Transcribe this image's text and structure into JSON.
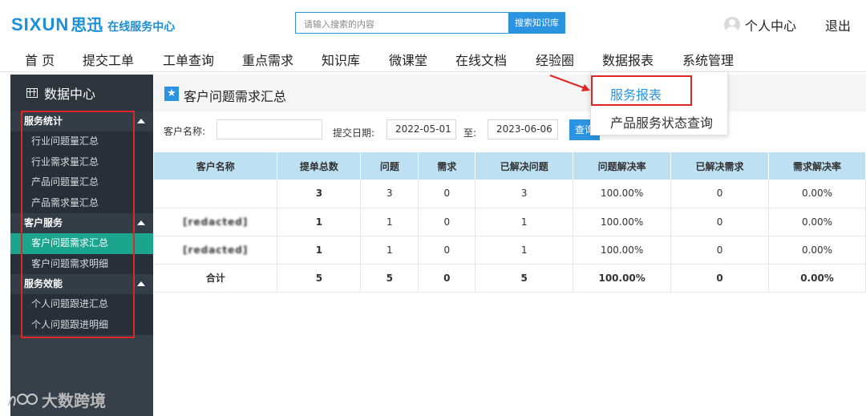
{
  "header": {
    "logo_text": "SIXUN",
    "logo_cn": "思迅",
    "logo_sub": "在线服务中心",
    "search_placeholder": "请输入搜索的内容",
    "search_button": "搜索知识库",
    "user_center": "个人中心",
    "logout": "退出"
  },
  "nav": {
    "items": [
      "首 页",
      "提交工单",
      "工单查询",
      "重点需求",
      "知识库",
      "微课堂",
      "在线文档",
      "经验圈",
      "数据报表",
      "系统管理"
    ],
    "active_index": 8
  },
  "dropdown": {
    "items": [
      "服务报表",
      "产品服务状态查询"
    ],
    "active": "服务报表"
  },
  "sidebar": {
    "title": "数据中心",
    "groups": [
      {
        "title": "服务统计",
        "items": [
          "行业问题量汇总",
          "行业需求量汇总",
          "产品问题量汇总",
          "产品需求量汇总"
        ]
      },
      {
        "title": "客户服务",
        "items": [
          "客户问题需求汇总",
          "客户问题需求明细"
        ]
      },
      {
        "title": "服务效能",
        "items": [
          "个人问题跟进汇总",
          "个人问题跟进明细"
        ]
      }
    ],
    "active_item": "客户问题需求汇总"
  },
  "content": {
    "title": "客户问题需求汇总",
    "filters": {
      "customer_label": "客户名称:",
      "customer_value": "",
      "date_label": "提交日期:",
      "date_from": "2022-05-01",
      "to_label": "至:",
      "date_to": "2023-06-06",
      "query_button": "查询"
    }
  },
  "table": {
    "headers": [
      "客户名称",
      "提单总数",
      "问题",
      "需求",
      "已解决问题",
      "问题解决率",
      "已解决需求",
      "需求解决率"
    ],
    "rows": [
      [
        "",
        "3",
        "3",
        "0",
        "3",
        "100.00%",
        "0",
        "0.00%"
      ],
      [
        "[redacted]",
        "1",
        "1",
        "0",
        "1",
        "100.00%",
        "0",
        "0.00%"
      ],
      [
        "[redacted]",
        "1",
        "1",
        "0",
        "1",
        "100.00%",
        "0",
        "0.00%"
      ]
    ],
    "total": [
      "合计",
      "5",
      "5",
      "0",
      "5",
      "100.00%",
      "0",
      "0.00%"
    ]
  },
  "watermark": "大数跨境"
}
